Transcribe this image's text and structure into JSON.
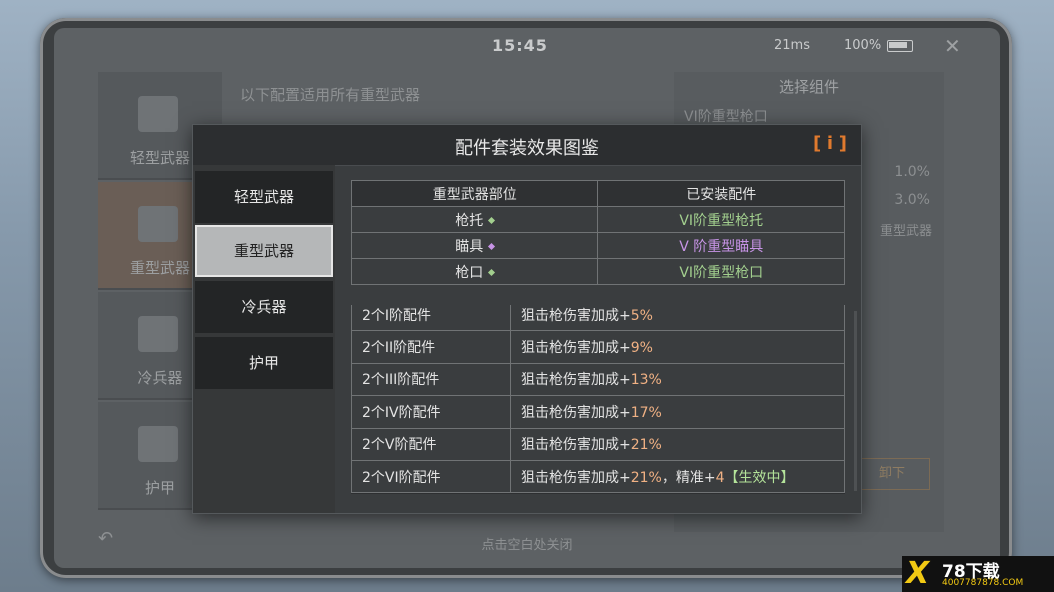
{
  "status": {
    "time": "15:45",
    "ping": "21ms",
    "battery": "100%"
  },
  "background": {
    "categories": [
      "轻型武器",
      "重型武器",
      "冷兵器",
      "护甲"
    ],
    "center_title": "以下配置适用所有重型武器",
    "right_header": "选择组件",
    "right_sub": "VI阶重型枪口",
    "right_pct1": "1.0%",
    "right_pct2": "3.0%",
    "right_tag": "重型武器",
    "right_btn": "卸下",
    "hint": "点击空白处关闭"
  },
  "modal": {
    "title": "配件套装效果图鉴",
    "info_icon": "i",
    "tabs": [
      "轻型武器",
      "重型武器",
      "冷兵器",
      "护甲"
    ],
    "active_tab": 1,
    "parts_table": {
      "headers": [
        "重型武器部位",
        "已安装配件"
      ],
      "rows": [
        {
          "slot": "枪托",
          "part": "VI阶重型枪托",
          "color": "#a2cf8e"
        },
        {
          "slot": "瞄具",
          "part": "V 阶重型瞄具",
          "color": "#c794e6"
        },
        {
          "slot": "枪口",
          "part": "VI阶重型枪口",
          "color": "#a2cf8e"
        }
      ]
    },
    "effects": [
      {
        "tier": "2个I阶配件",
        "text": "狙击枪伤害加成+",
        "bonus": "5%",
        "extra": ""
      },
      {
        "tier": "2个II阶配件",
        "text": "狙击枪伤害加成+",
        "bonus": "9%",
        "extra": ""
      },
      {
        "tier": "2个III阶配件",
        "text": "狙击枪伤害加成+",
        "bonus": "13%",
        "extra": ""
      },
      {
        "tier": "2个IV阶配件",
        "text": "狙击枪伤害加成+",
        "bonus": "17%",
        "extra": ""
      },
      {
        "tier": "2个V阶配件",
        "text": "狙击枪伤害加成+",
        "bonus": "21%",
        "extra": ""
      },
      {
        "tier": "2个VI阶配件",
        "text": "狙击枪伤害加成+",
        "bonus": "21%",
        "extra": "，精准+",
        "extra_val": "4",
        "active": "【生效中】"
      }
    ]
  },
  "watermark": {
    "logo": "X",
    "name": "78下载",
    "url": "4007787878.COM"
  }
}
